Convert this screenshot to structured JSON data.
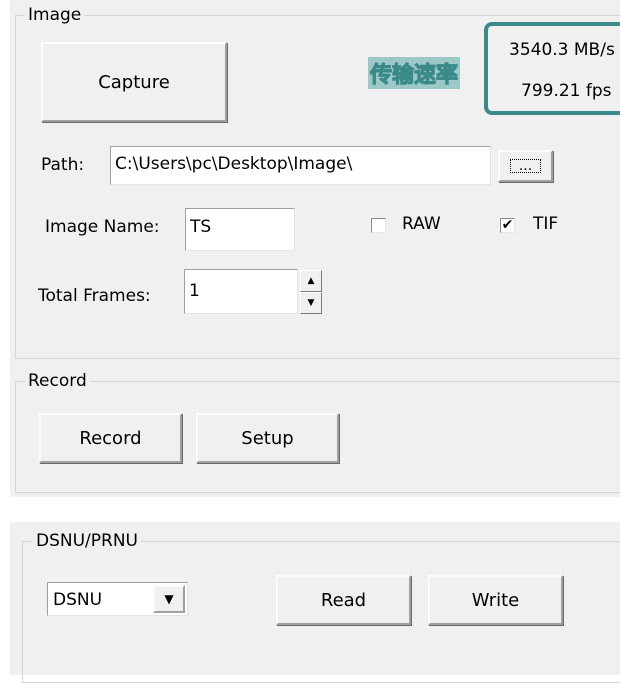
{
  "image_group": {
    "title": "Image",
    "capture_label": "Capture",
    "transfer_rate_label": "传输速率",
    "transfer_speed": "3540.3 MB/s",
    "frame_rate": "799.21 fps",
    "path_label": "Path:",
    "path_value": "C:\\Users\\pc\\Desktop\\Image\\",
    "browse_label": "...",
    "image_name_label": "Image Name:",
    "image_name_value": "TS",
    "raw_label": "RAW",
    "raw_checked": false,
    "tif_label": "TIF",
    "tif_checked": true,
    "check_mark": "✔",
    "total_frames_label": "Total Frames:",
    "total_frames_value": "1",
    "spin_up_icon": "▲",
    "spin_down_icon": "▼"
  },
  "record_group": {
    "title": "Record",
    "record_label": "Record",
    "setup_label": "Setup"
  },
  "dsnu_group": {
    "title": "DSNU/PRNU",
    "mode_value": "DSNU",
    "dropdown_icon": "▼",
    "read_label": "Read",
    "write_label": "Write"
  },
  "colors": {
    "panel_bg": "#f0f0f0",
    "rate_border": "#3a8a8a",
    "rate_label": "#5aa8a8"
  }
}
